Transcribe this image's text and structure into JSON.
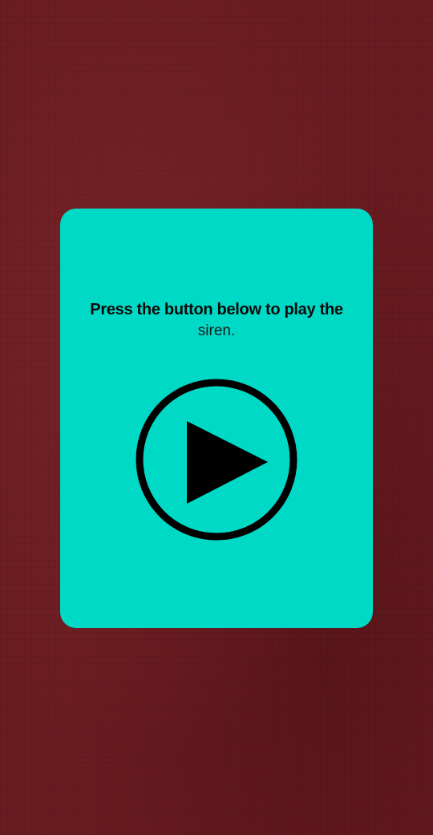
{
  "message": {
    "line1": "Press the button below to play the",
    "line2": "siren."
  },
  "play_button": {
    "icon": "play-circle-icon",
    "color": "#000000"
  },
  "colors": {
    "card_background": "#00d9c5",
    "page_background": "#6e1d22"
  }
}
